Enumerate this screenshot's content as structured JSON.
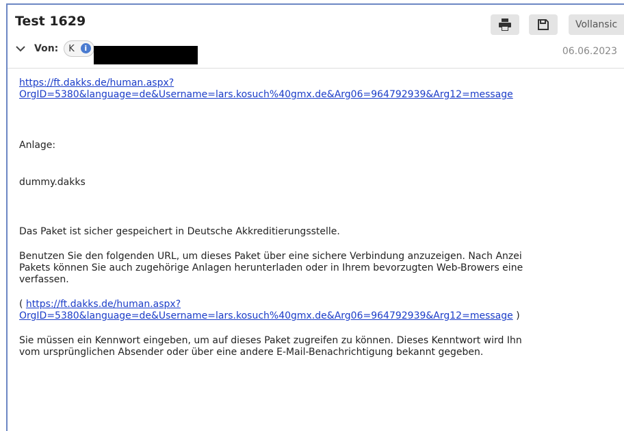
{
  "header": {
    "title": "Test 1629",
    "from_label": "Von:",
    "sender_chip": "K",
    "date": "06.06.2023",
    "full_view_label": "Vollansic"
  },
  "icons": {
    "print": "printer-icon",
    "save": "floppy-disk-icon",
    "collapse": "chevron-down-icon",
    "info": "info-icon"
  },
  "body": {
    "link1_line1": "https://ft.dakks.de/human.aspx?",
    "link1_line2": "OrgID=5380&language=de&Username=lars.kosuch%40gmx.de&Arg06=964792939&Arg12=message",
    "attachment_label": "Anlage:",
    "attachment_file": "dummy.dakks",
    "saved_text": "Das Paket ist sicher gespeichert in Deutsche Akkreditierungsstelle.",
    "instructions_line1": "Benutzen Sie den folgenden URL, um dieses Paket über eine sichere Verbindung anzuzeigen. Nach Anzei",
    "instructions_line2": "Pakets können Sie auch zugehörige Anlagen herunterladen oder in Ihrem bevorzugten Web-Browers eine",
    "instructions_line3": "verfassen.",
    "paren_open": "( ",
    "link2_line1": "https://ft.dakks.de/human.aspx?",
    "link2_line2": "OrgID=5380&language=de&Username=lars.kosuch%40gmx.de&Arg06=964792939&Arg12=message",
    "paren_close": " )",
    "password_line1": "Sie müssen ein Kennwort eingeben, um auf dieses Paket zugreifen zu können. Dieses Kenntwort wird Ihn",
    "password_line2": "vom ursprünglichen Absender oder über eine andere E-Mail-Benachrichtigung bekannt gegeben."
  }
}
